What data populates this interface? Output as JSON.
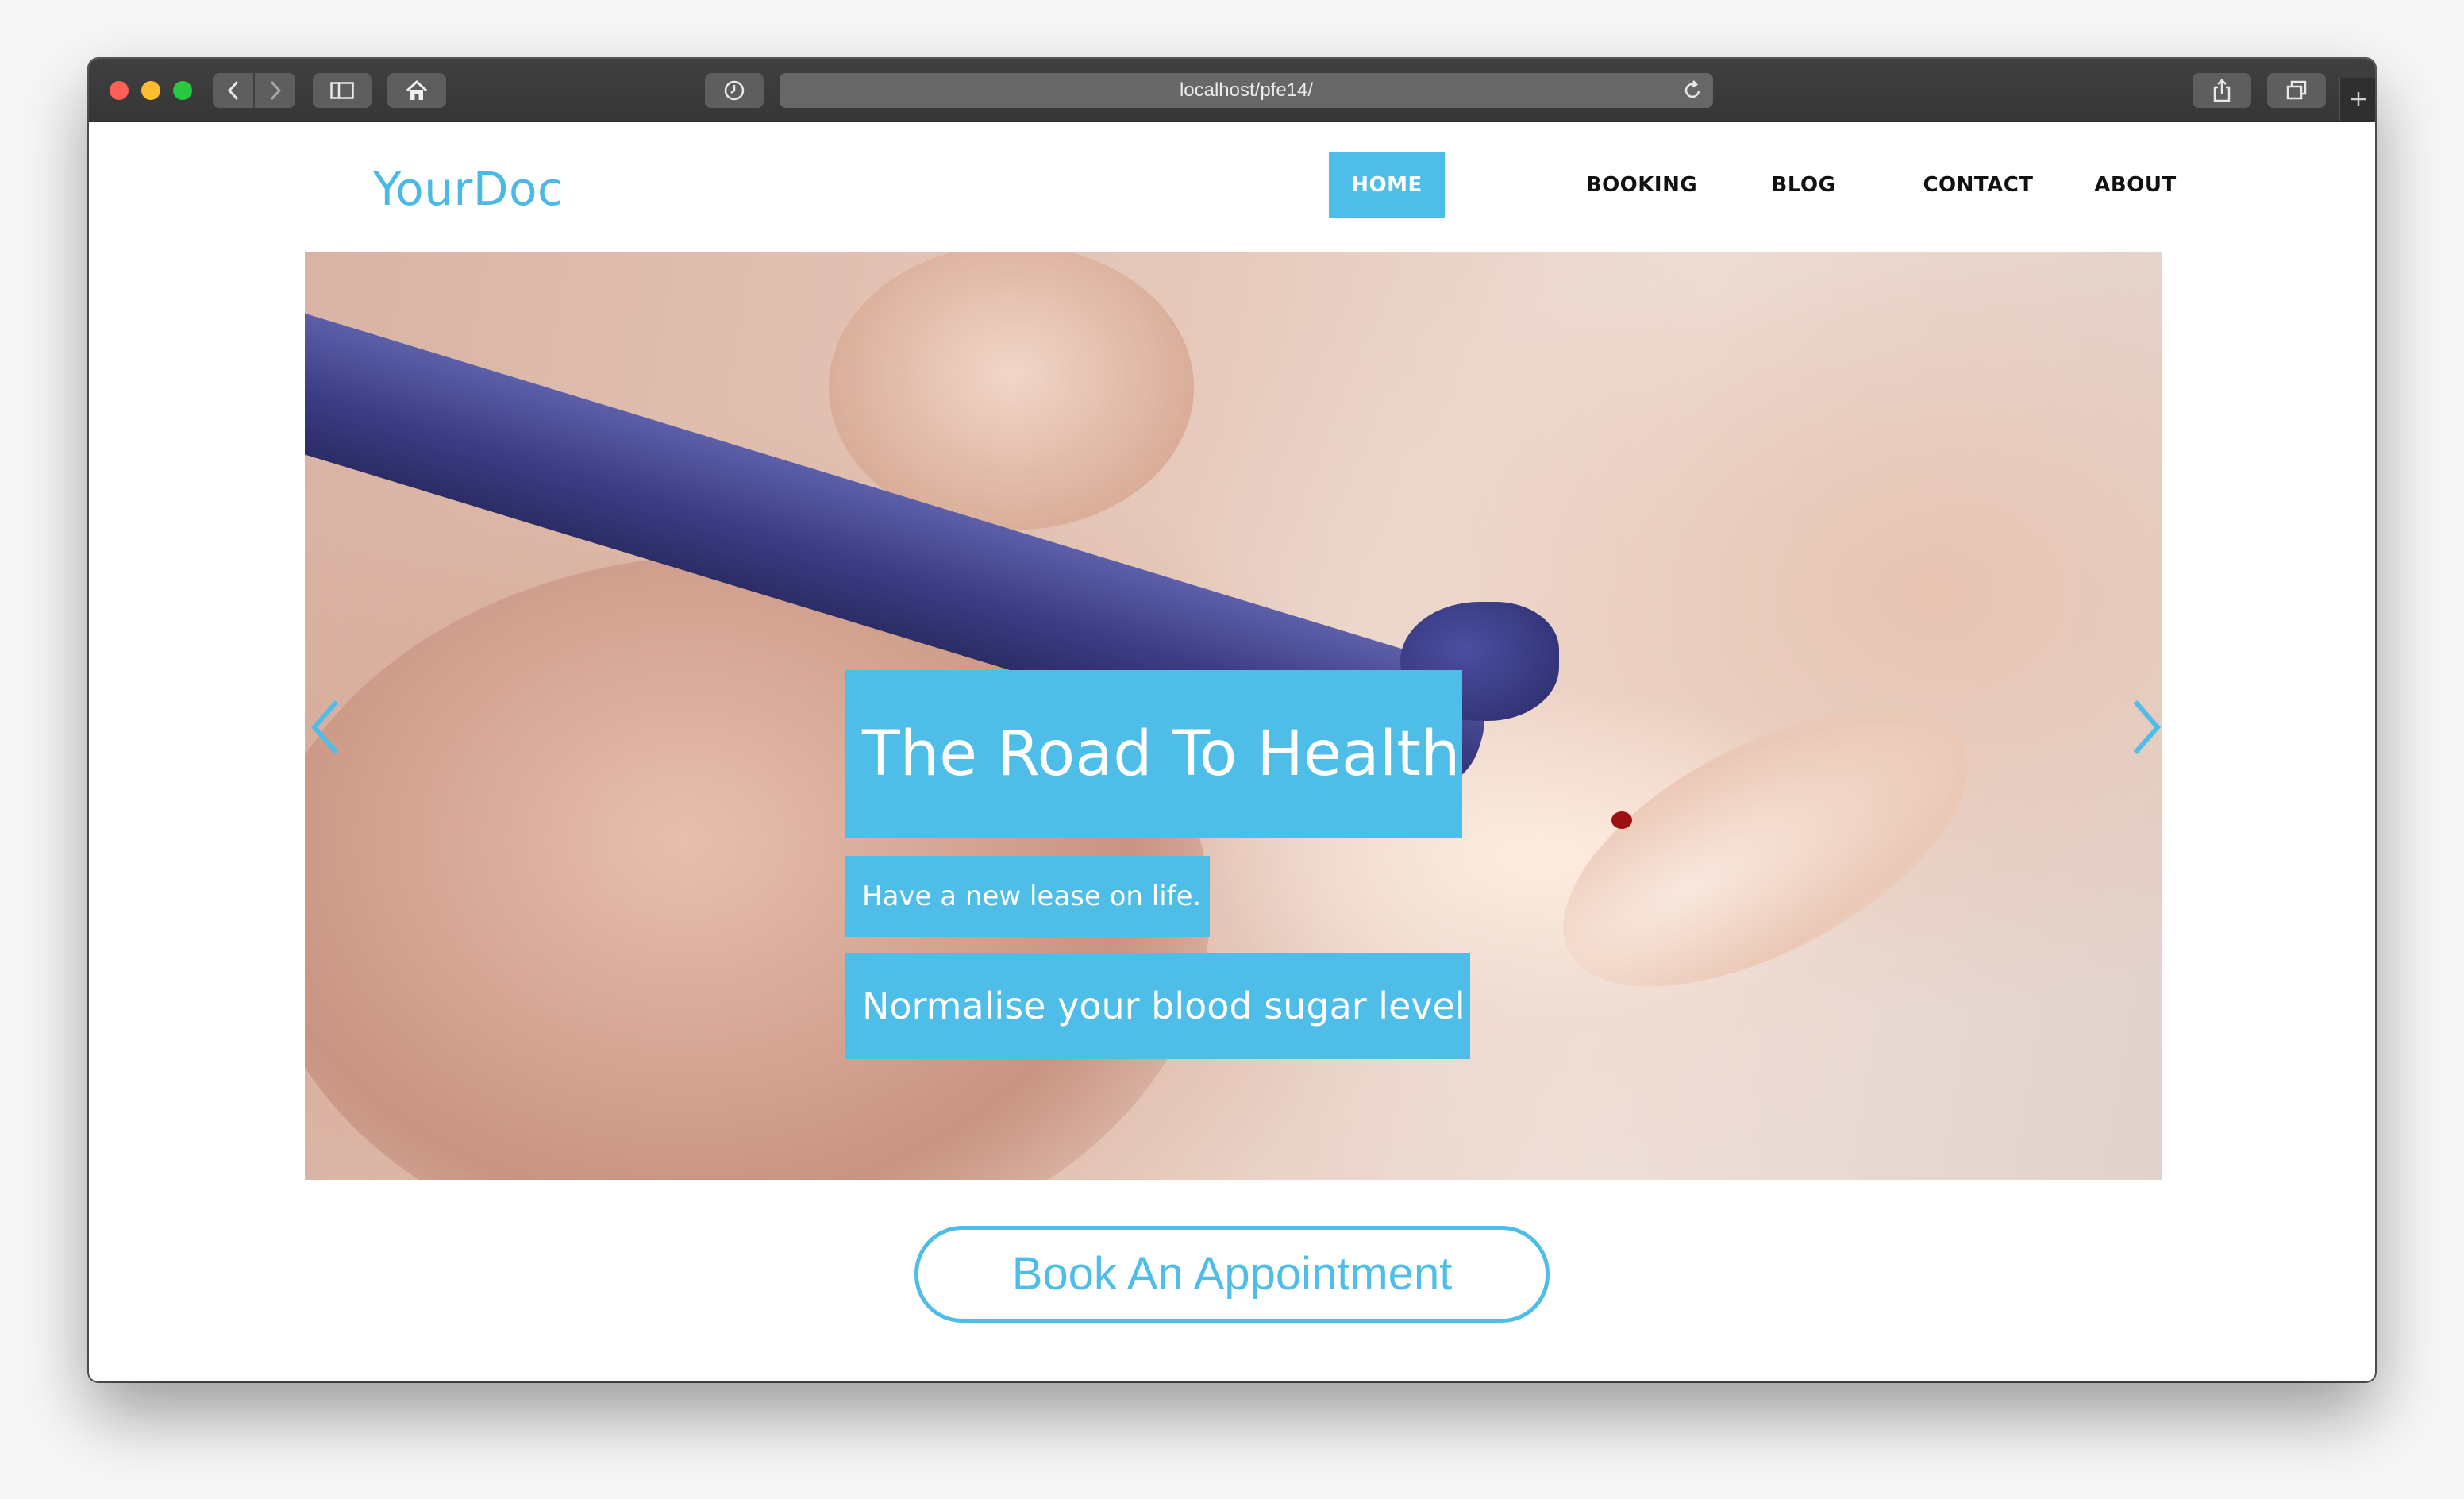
{
  "browser": {
    "url": "localhost/pfe14/",
    "icons": {
      "back": "chevron-left-icon",
      "forward": "chevron-right-icon",
      "sidebar": "sidebar-icon",
      "home": "home-icon",
      "history": "clock-icon",
      "reload": "reload-icon",
      "share": "share-icon",
      "tabs": "tabs-icon",
      "new_tab": "plus-icon"
    }
  },
  "site": {
    "logo": "YourDoc",
    "nav": [
      {
        "label": "HOME",
        "active": true
      },
      {
        "label": "BOOKING",
        "active": false
      },
      {
        "label": "BLOG",
        "active": false
      },
      {
        "label": "CONTACT",
        "active": false
      },
      {
        "label": "ABOUT",
        "active": false
      }
    ]
  },
  "hero": {
    "title": "The Road To Health",
    "subtitle": "Have a new lease on life.",
    "tagline": "Normalise your blood sugar level",
    "prev_icon": "chevron-left-icon",
    "next_icon": "chevron-right-icon"
  },
  "cta": {
    "label": "Book An Appointment"
  },
  "colors": {
    "accent": "#4ebde8",
    "toolbar": "#3a3a3a",
    "text": "#111111"
  }
}
